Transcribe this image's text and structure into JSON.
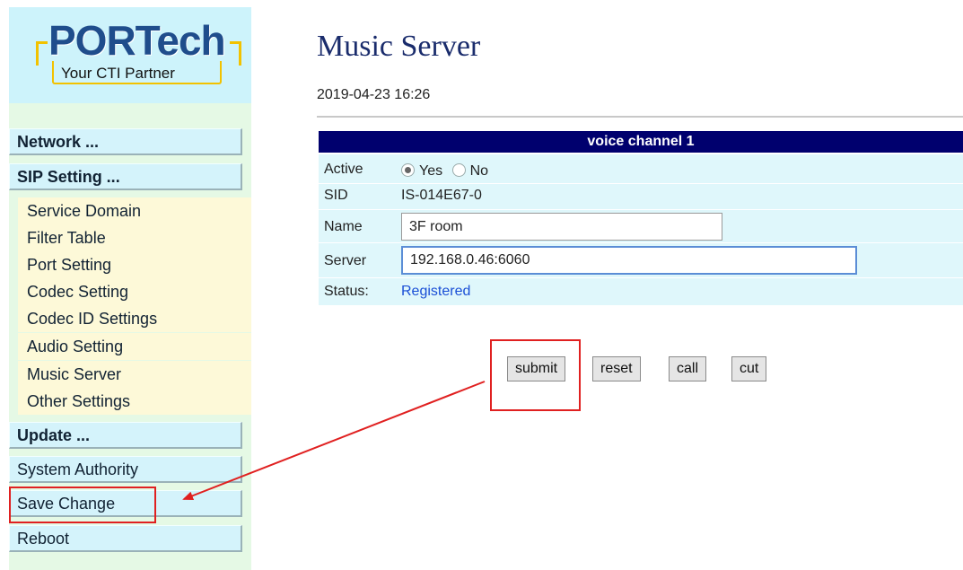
{
  "logo": {
    "brand": "PORTech",
    "tagline": "Your CTI Partner"
  },
  "sidebar": {
    "network": "Network ...",
    "sip_setting": "SIP Setting ...",
    "sub_items": [
      "Service Domain",
      "Filter Table",
      "Port Setting",
      "Codec Setting",
      "Codec ID Settings",
      "Audio Setting",
      "Music Server",
      "Other Settings"
    ],
    "update": "Update ...",
    "system_authority": "System Authority",
    "save_change": "Save Change",
    "reboot": "Reboot"
  },
  "page": {
    "title": "Music Server",
    "timestamp": "2019-04-23 16:26"
  },
  "channel": {
    "header": "voice channel 1",
    "active_label": "Active",
    "yes_label": "Yes",
    "no_label": "No",
    "active_selected": "Yes",
    "sid_label": "SID",
    "sid_value": "IS-014E67-0",
    "name_label": "Name",
    "name_value": "3F room",
    "server_label": "Server",
    "server_value": "192.168.0.46:6060",
    "status_label": "Status:",
    "status_value": "Registered"
  },
  "buttons": {
    "submit": "submit",
    "reset": "reset",
    "call": "call",
    "cut": "cut"
  },
  "colors": {
    "header_bg": "#00006e",
    "annotation": "#e02020",
    "status_link": "#1a4fd6"
  }
}
